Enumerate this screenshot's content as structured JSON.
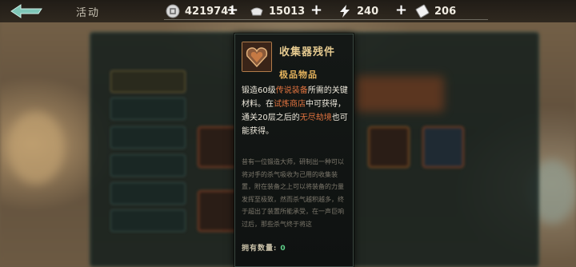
{
  "header": {
    "title": "活动",
    "resources": [
      {
        "icon": "silver-coin-icon",
        "value": "4219741"
      },
      {
        "icon": "ingot-icon",
        "value": "15013"
      },
      {
        "icon": "lightning-icon",
        "value": "240"
      },
      {
        "icon": "ticket-icon",
        "value": "206"
      }
    ]
  },
  "panel": {
    "side_items": [
      "",
      "",
      "",
      "",
      "",
      ""
    ]
  },
  "tooltip": {
    "name": "收集器残件",
    "rarity": "极品物品",
    "desc_parts": [
      {
        "text": "锻造60级",
        "highlight": false
      },
      {
        "text": "传说装备",
        "highlight": true
      },
      {
        "text": "所需的关键材料。在",
        "highlight": false
      },
      {
        "text": "试炼商店",
        "highlight": true
      },
      {
        "text": "中可获得，通关20层之后的",
        "highlight": false
      },
      {
        "text": "无尽劫境",
        "highlight": true
      },
      {
        "text": "也可能获得。",
        "highlight": false
      }
    ],
    "lore": "昔有一位锻造大师，研制出一种可以将对手的杀气吸收为己用的收集装置，附在装备之上可以将装备的力量发挥至极致，然而杀气越积越多，终于超出了装置所能承受，在一声巨响过后，那些杀气终于将这",
    "owned_label": "拥有数量:",
    "owned_count": "0"
  },
  "colors": {
    "highlight": "#e0733f",
    "name": "#e4c98f",
    "rarity": "#e4b25c",
    "owned_count": "#5fd18a"
  }
}
